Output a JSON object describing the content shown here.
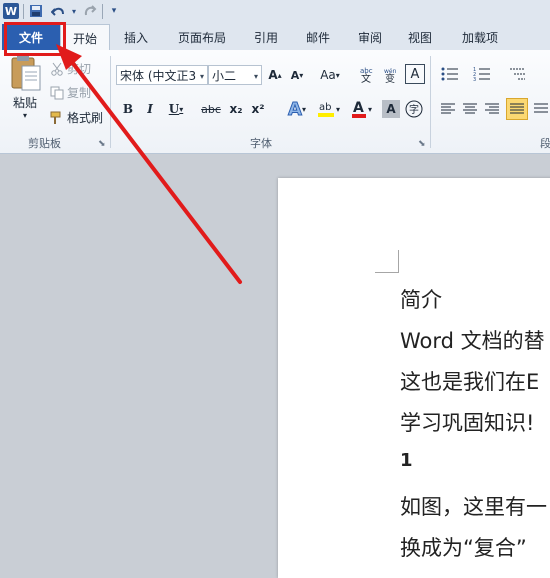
{
  "window": {
    "app_icon_letter": "W",
    "qat_icons": [
      "save-icon",
      "undo-icon",
      "redo-icon",
      "customize-qat-icon"
    ]
  },
  "tabs": [
    {
      "label": "文件",
      "active": false,
      "is_file": true
    },
    {
      "label": "开始",
      "active": true
    },
    {
      "label": "插入"
    },
    {
      "label": "页面布局"
    },
    {
      "label": "引用"
    },
    {
      "label": "邮件"
    },
    {
      "label": "审阅"
    },
    {
      "label": "视图"
    },
    {
      "label": "加载项"
    }
  ],
  "clipboard": {
    "paste_label": "粘贴",
    "cut_label": "剪切",
    "copy_label": "复制",
    "format_painter_label": "格式刷",
    "group_label": "剪贴板"
  },
  "font": {
    "font_name": "宋体 (中文正3",
    "font_size": "小二",
    "grow_label": "A",
    "shrink_label": "A",
    "case_label": "Aa",
    "bold": "B",
    "italic": "I",
    "underline": "U",
    "strike": "abc",
    "subscript": "x₂",
    "superscript": "x²",
    "clear_format_label": "A",
    "group_label": "字体"
  },
  "paragraph": {
    "group_label": "段"
  },
  "document": {
    "lines": [
      "简介",
      "Word 文档的替",
      "这也是我们在E",
      "学习巩固知识!",
      "1",
      "如图，这里有一",
      "换成为“复合”"
    ]
  },
  "colors": {
    "file_tab": "#2b5fb0",
    "highlight_box": "#e11b1b",
    "arrow": "#e11b1b",
    "ribbon_bg": "#f6f8fb"
  }
}
